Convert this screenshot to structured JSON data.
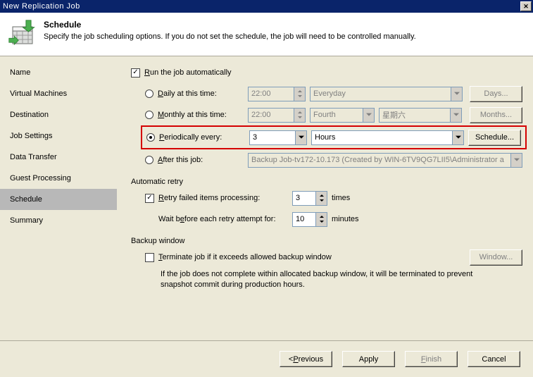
{
  "window": {
    "title": "New Replication Job"
  },
  "header": {
    "title": "Schedule",
    "subtitle": "Specify the job scheduling options. If you do not set the schedule, the job will need to be controlled manually."
  },
  "sidebar": {
    "items": [
      "Name",
      "Virtual Machines",
      "Destination",
      "Job Settings",
      "Data Transfer",
      "Guest Processing",
      "Schedule",
      "Summary"
    ],
    "selected_index": 6
  },
  "schedule": {
    "auto_checked": true,
    "auto_label_pre": "R",
    "auto_label_post": "un the job automatically",
    "daily": {
      "label_pre": "D",
      "label_post": "aily at this time:",
      "time": "22:00",
      "days": "Everyday",
      "btn": "Days..."
    },
    "monthly": {
      "label_pre": "M",
      "label_post": "onthly at this time:",
      "time": "22:00",
      "week": "Fourth",
      "day": "星期六",
      "btn": "Months..."
    },
    "periodic": {
      "label_pre": "P",
      "label_post": "eriodically every:",
      "value": "3",
      "unit": "Hours",
      "btn": "Schedule..."
    },
    "after": {
      "label_pre": "A",
      "label_post": "fter this job:",
      "job": "Backup Job-tv172-10.173 (Created by WIN-6TV9QG7LII5\\Administrator a"
    }
  },
  "retry": {
    "section": "Automatic retry",
    "enabled": true,
    "label_pre": "R",
    "label_post": "etry failed items processing:",
    "count": "3",
    "count_suffix": "times",
    "wait_pre": "Wait b",
    "wait_under": "e",
    "wait_post": "fore each retry attempt for:",
    "wait_val": "10",
    "wait_suffix": "minutes"
  },
  "window_section": {
    "title": "Backup window",
    "enabled": false,
    "label_pre": "T",
    "label_post": "erminate job if it exceeds allowed backup window",
    "btn": "Window...",
    "hint": "If the job does not complete within allocated backup window, it will be terminated to prevent snapshot commit during production hours."
  },
  "footer": {
    "previous_pre": "< ",
    "previous_under": "P",
    "previous_post": "revious",
    "apply": "Apply",
    "finish_under": "F",
    "finish_post": "inish",
    "cancel": "Cancel"
  }
}
